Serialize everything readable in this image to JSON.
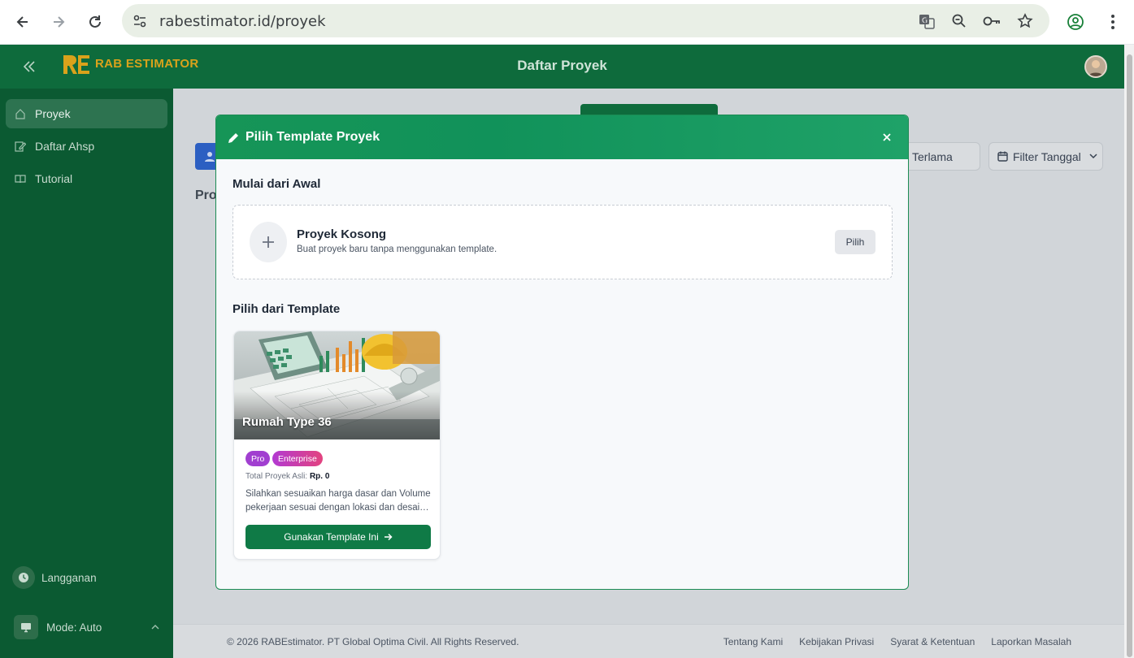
{
  "browser": {
    "url": "rabestimator.id/proyek"
  },
  "app": {
    "logo_text": "RAB ESTIMATOR",
    "page_title": "Daftar Proyek"
  },
  "sidebar": {
    "items": [
      {
        "label": "Proyek",
        "icon": "home-icon",
        "active": true
      },
      {
        "label": "Daftar Ahsp",
        "icon": "edit-document-icon",
        "active": false
      },
      {
        "label": "Tutorial",
        "icon": "book-icon",
        "active": false
      }
    ],
    "subscription_label": "Langganan",
    "mode_label": "Mode: Auto"
  },
  "background": {
    "section_partial": "Pro",
    "sort_label": "Terlama",
    "filter_label": "Filter Tanggal"
  },
  "modal": {
    "title": "Pilih Template Proyek",
    "start_section": "Mulai dari Awal",
    "blank": {
      "title": "Proyek Kosong",
      "description": "Buat proyek baru tanpa menggunakan template.",
      "button": "Pilih"
    },
    "template_section": "Pilih dari Template",
    "templates": [
      {
        "name": "Rumah Type 36",
        "badges": [
          "Pro",
          "Enterprise"
        ],
        "total_label": "Total Proyek Asli:",
        "total_value": "Rp. 0",
        "description": "Silahkan sesuaikan harga dasar dan Volume pekerjaan sesuai dengan lokasi dan desai…",
        "button": "Gunakan Template Ini"
      }
    ]
  },
  "footer": {
    "copyright": "© 2026 RABEstimator. PT Global Optima Civil. All Rights Reserved.",
    "links": [
      "Tentang Kami",
      "Kebijakan Privasi",
      "Syarat & Ketentuan",
      "Laporkan Masalah"
    ]
  },
  "colors": {
    "primary": "#0e6b3c",
    "sidebar": "#0b5a32",
    "accent_gold": "#d9a21b",
    "button_green": "#0f7a46"
  }
}
